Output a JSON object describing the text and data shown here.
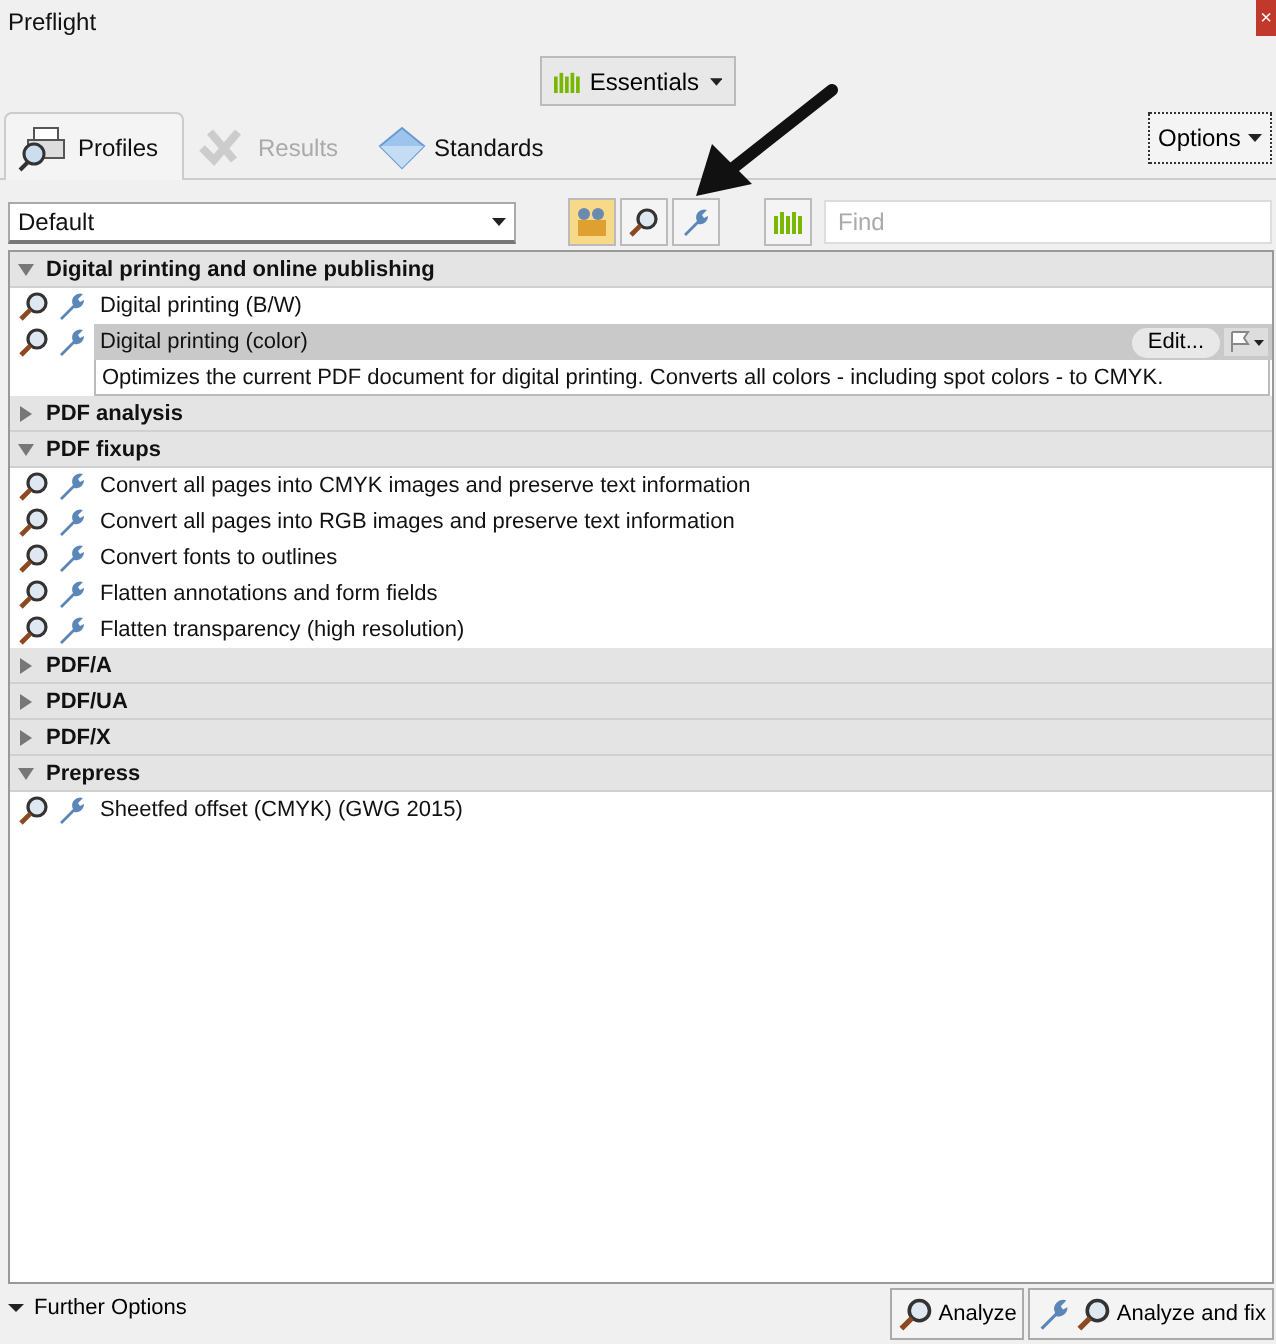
{
  "window": {
    "title": "Preflight",
    "close": "×"
  },
  "workspace_button": {
    "label": "Essentials"
  },
  "tabs": [
    {
      "label": "Profiles",
      "selected": true,
      "disabled": false,
      "kind": "printer"
    },
    {
      "label": "Results",
      "selected": false,
      "disabled": true,
      "kind": "checks"
    },
    {
      "label": "Standards",
      "selected": false,
      "disabled": false,
      "kind": "diamond"
    }
  ],
  "options_button": {
    "label": "Options"
  },
  "profile_dropdown": {
    "value": "Default"
  },
  "toolbar": [
    {
      "kind": "box",
      "selected": true
    },
    {
      "kind": "magnifier",
      "selected": false
    },
    {
      "kind": "wrench",
      "selected": false
    },
    {
      "kind": "bars",
      "selected": false
    }
  ],
  "search": {
    "placeholder": "Find"
  },
  "groups": [
    {
      "title": "Digital printing and online publishing",
      "expanded": true,
      "items": [
        {
          "label": "Digital printing (B/W)",
          "selected": false
        },
        {
          "label": "Digital printing (color)",
          "selected": true,
          "action": "Edit...",
          "description": "Optimizes the current PDF document for digital printing. Converts all colors - including spot colors - to CMYK."
        }
      ]
    },
    {
      "title": "PDF analysis",
      "expanded": false
    },
    {
      "title": "PDF fixups",
      "expanded": true,
      "items": [
        {
          "label": "Convert all pages into CMYK images and preserve text information",
          "selected": false
        },
        {
          "label": "Convert all pages into RGB images and preserve text information",
          "selected": false
        },
        {
          "label": "Convert fonts to outlines",
          "selected": false
        },
        {
          "label": "Flatten annotations and form fields",
          "selected": false
        },
        {
          "label": "Flatten transparency (high resolution)",
          "selected": false
        }
      ]
    },
    {
      "title": "PDF/A",
      "expanded": false
    },
    {
      "title": "PDF/UA",
      "expanded": false
    },
    {
      "title": "PDF/X",
      "expanded": false
    },
    {
      "title": "Prepress",
      "expanded": true,
      "items": [
        {
          "label": "Sheetfed offset (CMYK) (GWG 2015)",
          "selected": false
        }
      ]
    }
  ],
  "further_options": {
    "label": "Further Options",
    "expanded": true
  },
  "buttons": [
    {
      "label": "Analyze",
      "kind": "analyze"
    },
    {
      "label": "Analyze and fix",
      "kind": "fix"
    }
  ]
}
